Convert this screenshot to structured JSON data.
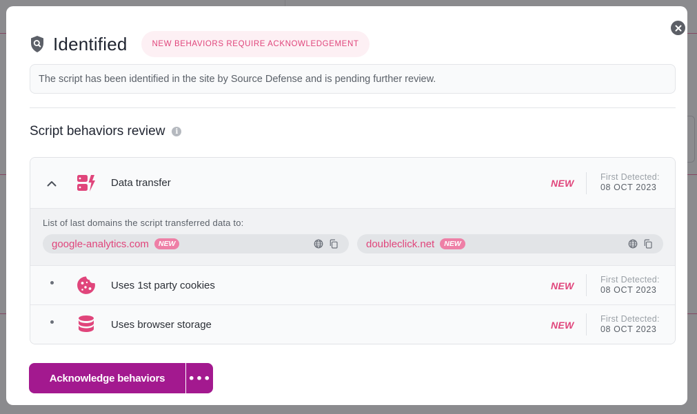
{
  "modal": {
    "title": "Identified",
    "status_badge": "NEW BEHAVIORS REQUIRE ACKNOWLEDGEMENT",
    "description": "The script has been identified in the site by Source Defense and is pending further review.",
    "section_title": "Script behaviors review"
  },
  "behaviors": [
    {
      "label": "Data transfer",
      "tag": "NEW",
      "detected_label": "First Detected:",
      "detected_date": "08 OCT 2023",
      "icon": "data-transfer-icon",
      "expanded": true
    },
    {
      "label": "Uses 1st party cookies",
      "tag": "NEW",
      "detected_label": "First Detected:",
      "detected_date": "08 OCT 2023",
      "icon": "cookie-icon"
    },
    {
      "label": "Uses browser storage",
      "tag": "NEW",
      "detected_label": "First Detected:",
      "detected_date": "08 OCT 2023",
      "icon": "database-icon"
    }
  ],
  "domains": {
    "caption": "List of last domains the script transferred data to:",
    "items": [
      {
        "name": "google-analytics.com",
        "tag": "NEW"
      },
      {
        "name": "doubleclick.net",
        "tag": "NEW"
      }
    ]
  },
  "actions": {
    "primary_label": "Acknowledge behaviors",
    "more_label": "•••"
  },
  "colors": {
    "accent": "#e0457b",
    "primary_button": "#a3198f",
    "badge_bg": "#fdf0f4"
  }
}
